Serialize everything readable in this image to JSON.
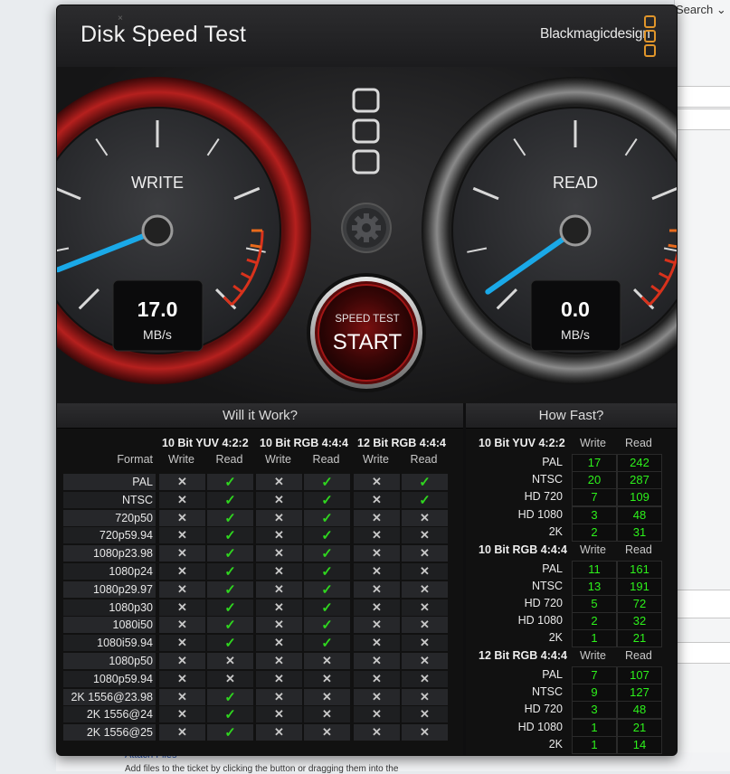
{
  "background": {
    "search_label": "Search",
    "attach_link": "Attach Files",
    "body_text": "Add files to the ticket by clicking the button or dragging them into the"
  },
  "window": {
    "title": "Disk Speed Test",
    "brand": "Blackmagicdesign",
    "close_symbol": "×"
  },
  "gauges": {
    "write": {
      "label": "WRITE",
      "value": "17.0",
      "unit": "MB/s",
      "needle_fraction": 0.05
    },
    "read": {
      "label": "READ",
      "value": "0.0",
      "unit": "MB/s",
      "needle_fraction": 0.0
    },
    "start_button": {
      "caption": "SPEED TEST",
      "label": "START"
    },
    "settings_icon": "gear-icon",
    "drive_icon": "drive-slots-icon"
  },
  "will_it_work": {
    "title": "Will it Work?",
    "format_header": "Format",
    "column_groups": [
      "10 Bit YUV 4:2:2",
      "10 Bit RGB 4:4:4",
      "12 Bit RGB 4:4:4"
    ],
    "sub_headers": [
      "Write",
      "Read"
    ],
    "rows": [
      {
        "format": "PAL",
        "results": [
          "x",
          "ok",
          "x",
          "ok",
          "x",
          "ok"
        ]
      },
      {
        "format": "NTSC",
        "results": [
          "x",
          "ok",
          "x",
          "ok",
          "x",
          "ok"
        ]
      },
      {
        "format": "720p50",
        "results": [
          "x",
          "ok",
          "x",
          "ok",
          "x",
          "x"
        ]
      },
      {
        "format": "720p59.94",
        "results": [
          "x",
          "ok",
          "x",
          "ok",
          "x",
          "x"
        ]
      },
      {
        "format": "1080p23.98",
        "results": [
          "x",
          "ok",
          "x",
          "ok",
          "x",
          "x"
        ]
      },
      {
        "format": "1080p24",
        "results": [
          "x",
          "ok",
          "x",
          "ok",
          "x",
          "x"
        ]
      },
      {
        "format": "1080p29.97",
        "results": [
          "x",
          "ok",
          "x",
          "ok",
          "x",
          "x"
        ]
      },
      {
        "format": "1080p30",
        "results": [
          "x",
          "ok",
          "x",
          "ok",
          "x",
          "x"
        ]
      },
      {
        "format": "1080i50",
        "results": [
          "x",
          "ok",
          "x",
          "ok",
          "x",
          "x"
        ]
      },
      {
        "format": "1080i59.94",
        "results": [
          "x",
          "ok",
          "x",
          "ok",
          "x",
          "x"
        ]
      },
      {
        "format": "1080p50",
        "results": [
          "x",
          "x",
          "x",
          "x",
          "x",
          "x"
        ]
      },
      {
        "format": "1080p59.94",
        "results": [
          "x",
          "x",
          "x",
          "x",
          "x",
          "x"
        ]
      },
      {
        "format": "2K 1556@23.98",
        "results": [
          "x",
          "ok",
          "x",
          "x",
          "x",
          "x"
        ]
      },
      {
        "format": "2K 1556@24",
        "results": [
          "x",
          "ok",
          "x",
          "x",
          "x",
          "x"
        ]
      },
      {
        "format": "2K 1556@25",
        "results": [
          "x",
          "ok",
          "x",
          "x",
          "x",
          "x"
        ]
      }
    ]
  },
  "how_fast": {
    "title": "How Fast?",
    "sub_headers": [
      "Write",
      "Read"
    ],
    "groups": [
      {
        "name": "10 Bit YUV 4:2:2",
        "rows": [
          {
            "label": "PAL",
            "write": "17",
            "read": "242"
          },
          {
            "label": "NTSC",
            "write": "20",
            "read": "287"
          },
          {
            "label": "HD 720",
            "write": "7",
            "read": "109"
          },
          {
            "label": "HD 1080",
            "write": "3",
            "read": "48"
          },
          {
            "label": "2K",
            "write": "2",
            "read": "31"
          }
        ]
      },
      {
        "name": "10 Bit RGB 4:4:4",
        "rows": [
          {
            "label": "PAL",
            "write": "11",
            "read": "161"
          },
          {
            "label": "NTSC",
            "write": "13",
            "read": "191"
          },
          {
            "label": "HD 720",
            "write": "5",
            "read": "72"
          },
          {
            "label": "HD 1080",
            "write": "2",
            "read": "32"
          },
          {
            "label": "2K",
            "write": "1",
            "read": "21"
          }
        ]
      },
      {
        "name": "12 Bit RGB 4:4:4",
        "rows": [
          {
            "label": "PAL",
            "write": "7",
            "read": "107"
          },
          {
            "label": "NTSC",
            "write": "9",
            "read": "127"
          },
          {
            "label": "HD 720",
            "write": "3",
            "read": "48"
          },
          {
            "label": "HD 1080",
            "write": "1",
            "read": "21"
          },
          {
            "label": "2K",
            "write": "1",
            "read": "14"
          }
        ]
      }
    ]
  }
}
